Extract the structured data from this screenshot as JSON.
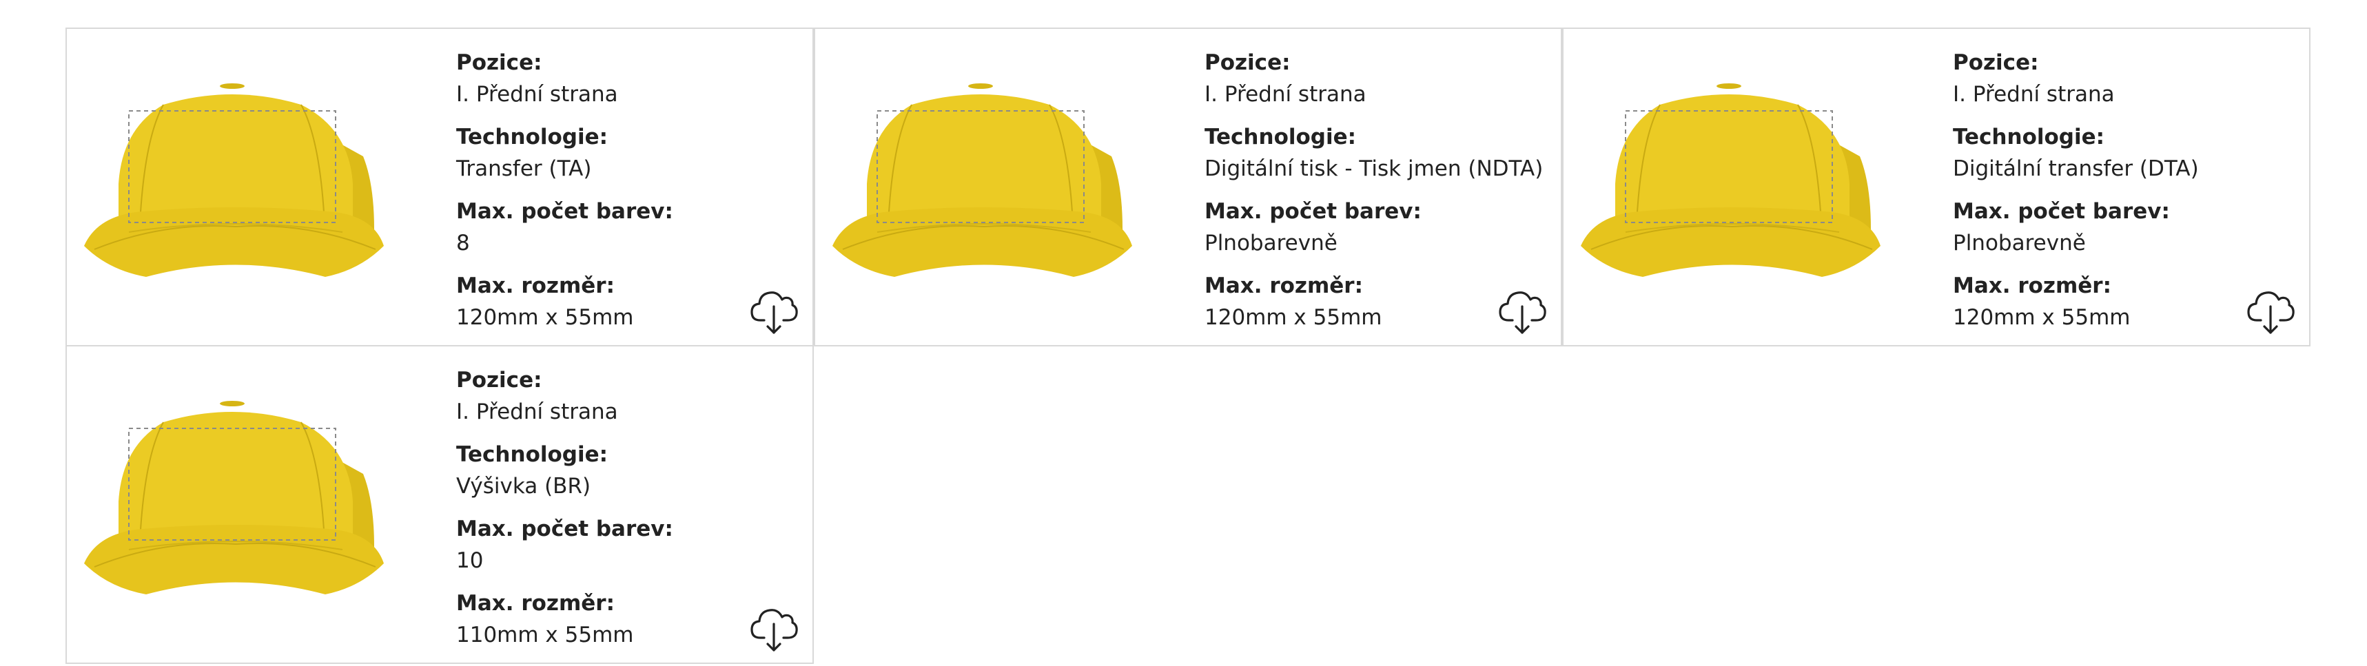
{
  "accent_color": "#e9c91f",
  "download_icon": "cloud-download-icon",
  "cards": [
    {
      "position_label": "Pozice:",
      "position_value": "I. Přední strana",
      "technology_label": "Technologie:",
      "technology_value": "Transfer (TA)",
      "colors_label": "Max. počet barev:",
      "colors_value": "8",
      "size_label": "Max. rozměr:",
      "size_value": "120mm x 55mm"
    },
    {
      "position_label": "Pozice:",
      "position_value": "I. Přední strana",
      "technology_label": "Technologie:",
      "technology_value": "Digitální tisk - Tisk jmen (NDTA)",
      "colors_label": "Max. počet barev:",
      "colors_value": "Plnobarevně",
      "size_label": "Max. rozměr:",
      "size_value": "120mm x 55mm"
    },
    {
      "position_label": "Pozice:",
      "position_value": "I. Přední strana",
      "technology_label": "Technologie:",
      "technology_value": "Digitální transfer (DTA)",
      "colors_label": "Max. počet barev:",
      "colors_value": "Plnobarevně",
      "size_label": "Max. rozměr:",
      "size_value": "120mm x 55mm"
    },
    {
      "position_label": "Pozice:",
      "position_value": "I. Přední strana",
      "technology_label": "Technologie:",
      "technology_value": "Výšivka (BR)",
      "colors_label": "Max. počet barev:",
      "colors_value": "10",
      "size_label": "Max. rozměr:",
      "size_value": "110mm x 55mm"
    }
  ]
}
